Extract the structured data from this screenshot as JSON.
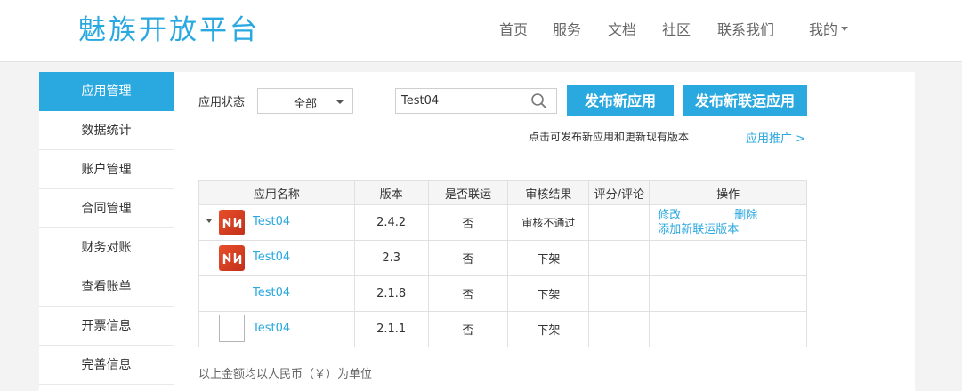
{
  "header": {
    "logo": "魅族开放平台",
    "nav": [
      "首页",
      "服务",
      "文档",
      "社区",
      "联系我们"
    ],
    "user_menu": "我的"
  },
  "sidebar": {
    "items": [
      "应用管理",
      "数据统计",
      "账户管理",
      "合同管理",
      "财务对账",
      "查看账单",
      "开票信息",
      "完善信息"
    ],
    "active_index": 0
  },
  "filters": {
    "status_label": "应用状态",
    "status_value": "全部",
    "search_value": "Test04"
  },
  "buttons": {
    "publish_app": "发布新应用",
    "publish_joint": "发布新联运应用"
  },
  "hint": "点击可发布新应用和更新现有版本",
  "promo_link": "应用推广 >",
  "table": {
    "headers": [
      "应用名称",
      "版本",
      "是否联运",
      "审核结果",
      "评分/评论",
      "操作"
    ],
    "rows": [
      {
        "name": "Test04",
        "version": "2.4.2",
        "joint": "否",
        "review": "审核不通过",
        "rating": "",
        "ops": {
          "edit": "修改",
          "delete": "删除",
          "add_joint": "添加新联运版本"
        }
      },
      {
        "name": "Test04",
        "version": "2.3",
        "joint": "否",
        "review": "下架",
        "rating": ""
      },
      {
        "name": "Test04",
        "version": "2.1.8",
        "joint": "否",
        "review": "下架",
        "rating": ""
      },
      {
        "name": "Test04",
        "version": "2.1.1",
        "joint": "否",
        "review": "下架",
        "rating": ""
      }
    ]
  },
  "footnote": "以上金额均以人民币（￥）为单位",
  "colors": {
    "accent": "#2aa8e0",
    "review_fail": "#e7901e",
    "offline": "#d43e1c",
    "app_icon": "#d83c20"
  }
}
